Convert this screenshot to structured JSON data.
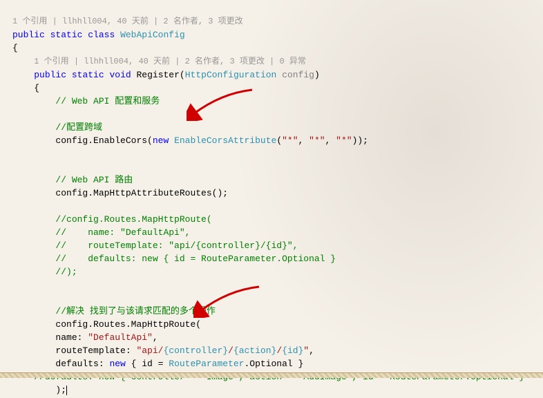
{
  "codelens": {
    "outer": "1 个引用 | llhhll004, 40 天前 | 2 名作者, 3 项更改",
    "inner": "1 个引用 | llhhll004, 40 天前 | 2 名作者, 3 项更改 | 0 异常"
  },
  "kw": {
    "public": "public",
    "static": "static",
    "class": "class",
    "void": "void",
    "new": "new"
  },
  "types": {
    "WebApiConfig": "WebApiConfig",
    "HttpConfiguration": "HttpConfiguration",
    "EnableCorsAttribute": "EnableCorsAttribute",
    "RouteParameter": "RouteParameter"
  },
  "method": {
    "Register": "Register",
    "configParam": "config"
  },
  "braces": {
    "open": "{",
    "close": "}"
  },
  "punct": {
    "lparen": "(",
    "rparen": ")",
    "semi": ";",
    "comma": ", ",
    "dot": "."
  },
  "comments": {
    "c1": "// Web API 配置和服务",
    "c2": "//配置跨域",
    "c3": "// Web API 路由",
    "c4": "//config.Routes.MapHttpRoute(",
    "c5": "//    name: \"DefaultApi\",",
    "c6": "//    routeTemplate: \"api/{controller}/{id}\",",
    "c7": "//    defaults: new { id = RouteParameter.Optional }",
    "c8": "//);",
    "c9": "//解决 找到了与该请求匹配的多个操作",
    "c10": "//defaults: new { controller = \"Image\", action = \"AddImage\", id = RouteParameter.Optional }"
  },
  "code": {
    "enableCors": "config.EnableCors",
    "mapAttr": "config.MapHttpAttributeRoutes();",
    "mapHttpRoute": "config.Routes.MapHttpRoute(",
    "nameLabel": "name: ",
    "routeTemplateLabel": "routeTemplate: ",
    "defaultsLabel": "defaults: ",
    "idEq": " id = ",
    "optional": "Optional"
  },
  "strings": {
    "star": "\"*\"",
    "defaultApi": "\"DefaultApi\"",
    "routeTplPrefix": "\"api/",
    "routeTplController": "{controller}",
    "routeTplSep": "/",
    "routeTplAction": "{action}",
    "routeTplId": "{id}",
    "routeTplEnd": "\""
  }
}
